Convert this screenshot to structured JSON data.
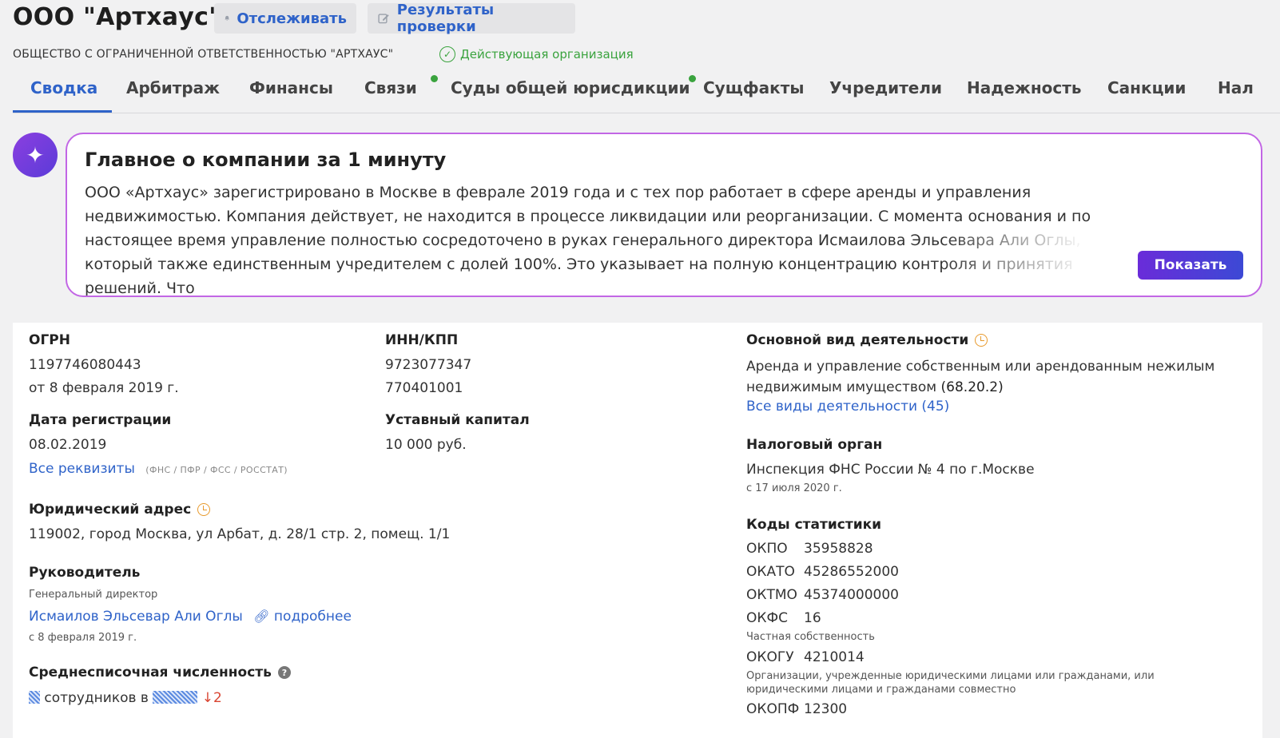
{
  "header": {
    "title": "ООО \"Артхаус\"",
    "track_label": "Отслеживать",
    "check_label": "Результаты проверки",
    "full_name": "ОБЩЕСТВО С ОГРАНИЧЕННОЙ ОТВЕТСТВЕННОСТЬЮ \"АРТХАУС\"",
    "status": "Действующая организация"
  },
  "tabs": [
    {
      "label": "Сводка",
      "active": true
    },
    {
      "label": "Арбитраж"
    },
    {
      "label": "Финансы"
    },
    {
      "label": "Связи",
      "dot": true
    },
    {
      "label": "Суды общей юрисдикции",
      "dot": true
    },
    {
      "label": "Сущфакты"
    },
    {
      "label": "Учредители"
    },
    {
      "label": "Надежность"
    },
    {
      "label": "Санкции"
    },
    {
      "label": "Нал"
    }
  ],
  "ai_summary": {
    "title": "Главное о компании за 1 минуту",
    "text": "ООО «Артхаус» зарегистрировано в Москве в феврале 2019 года и с тех пор работает в сфере аренды и управления недвижимостью. Компания действует, не находится в процессе ликвидации или реорганизации. С момента основания и по настоящее время управление полностью сосредоточено в руках генерального директора Исмаилова Эльсевара Али Оглы, который также единственным учредителем с долей 100%. Это указывает на полную концентрацию контроля и принятия решений. Что",
    "show_label": "Показать"
  },
  "details": {
    "ogrn_label": "ОГРН",
    "ogrn": "1197746080443",
    "ogrn_date": "от 8 февраля 2019 г.",
    "reg_date_label": "Дата регистрации",
    "reg_date": "08.02.2019",
    "all_requisites": "Все реквизиты",
    "requisites_note": "(ФНС / ПФР / ФСС / РОССТАТ)",
    "inn_label": "ИНН/КПП",
    "inn": "9723077347",
    "kpp": "770401001",
    "capital_label": "Уставный капитал",
    "capital": "10 000 руб.",
    "address_label": "Юридический адрес",
    "address": "119002, город Москва, ул Арбат, д. 28/1 стр. 2, помещ. 1/1",
    "head_label": "Руководитель",
    "head_role": "Генеральный директор",
    "head_name": "Исмаилов Эльсевар Али Оглы",
    "head_more": "подробнее",
    "head_since": "с 8 февраля 2019 г.",
    "staff_label": "Среднесписочная численность",
    "staff_text": "сотрудников в",
    "staff_change": "↓2",
    "activity_label": "Основной вид деятельности",
    "activity": "Аренда и управление собственным или арендованным нежилым недвижимым имуществом",
    "activity_code": "(68.20.2)",
    "all_activities": "Все виды деятельности (45)",
    "tax_label": "Налоговый орган",
    "tax": "Инспекция ФНС России № 4 по г.Москве",
    "tax_since": "с 17 июля 2020 г.",
    "codes_label": "Коды статистики",
    "okpo_k": "ОКПО",
    "okpo": "35958828",
    "okato_k": "ОКАТО",
    "okato": "45286552000",
    "oktmo_k": "ОКТМО",
    "oktmo": "45374000000",
    "okfs_k": "ОКФС",
    "okfs": "16",
    "okfs_note": "Частная собственность",
    "okogu_k": "ОКОГУ",
    "okogu": "4210014",
    "okogu_note": "Организации, учрежденные юридическими лицами или гражданами, или юридическими лицами и гражданами совместно",
    "okopf_k": "ОКОПФ",
    "okopf": "12300"
  }
}
